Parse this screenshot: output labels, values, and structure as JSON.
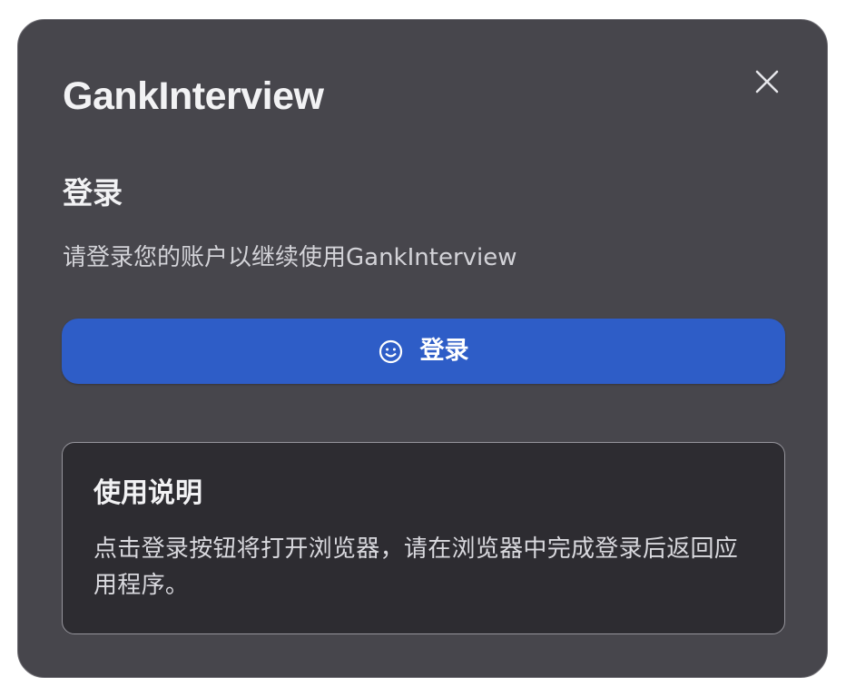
{
  "dialog": {
    "app_title": "GankInterview",
    "close_icon": "close-icon",
    "section_heading": "登录",
    "subtitle": "请登录您的账户以继续使用GankInterview",
    "login_button": {
      "icon": "smile-icon",
      "label": "登录",
      "color": "#2e5dc7"
    },
    "instructions": {
      "title": "使用说明",
      "text": "点击登录按钮将打开浏览器，请在浏览器中完成登录后返回应用程序。"
    }
  },
  "colors": {
    "dialog_background": "#47464c",
    "info_background": "#2d2c31",
    "text_primary": "#f2f2f4",
    "accent": "#2e5dc7"
  }
}
